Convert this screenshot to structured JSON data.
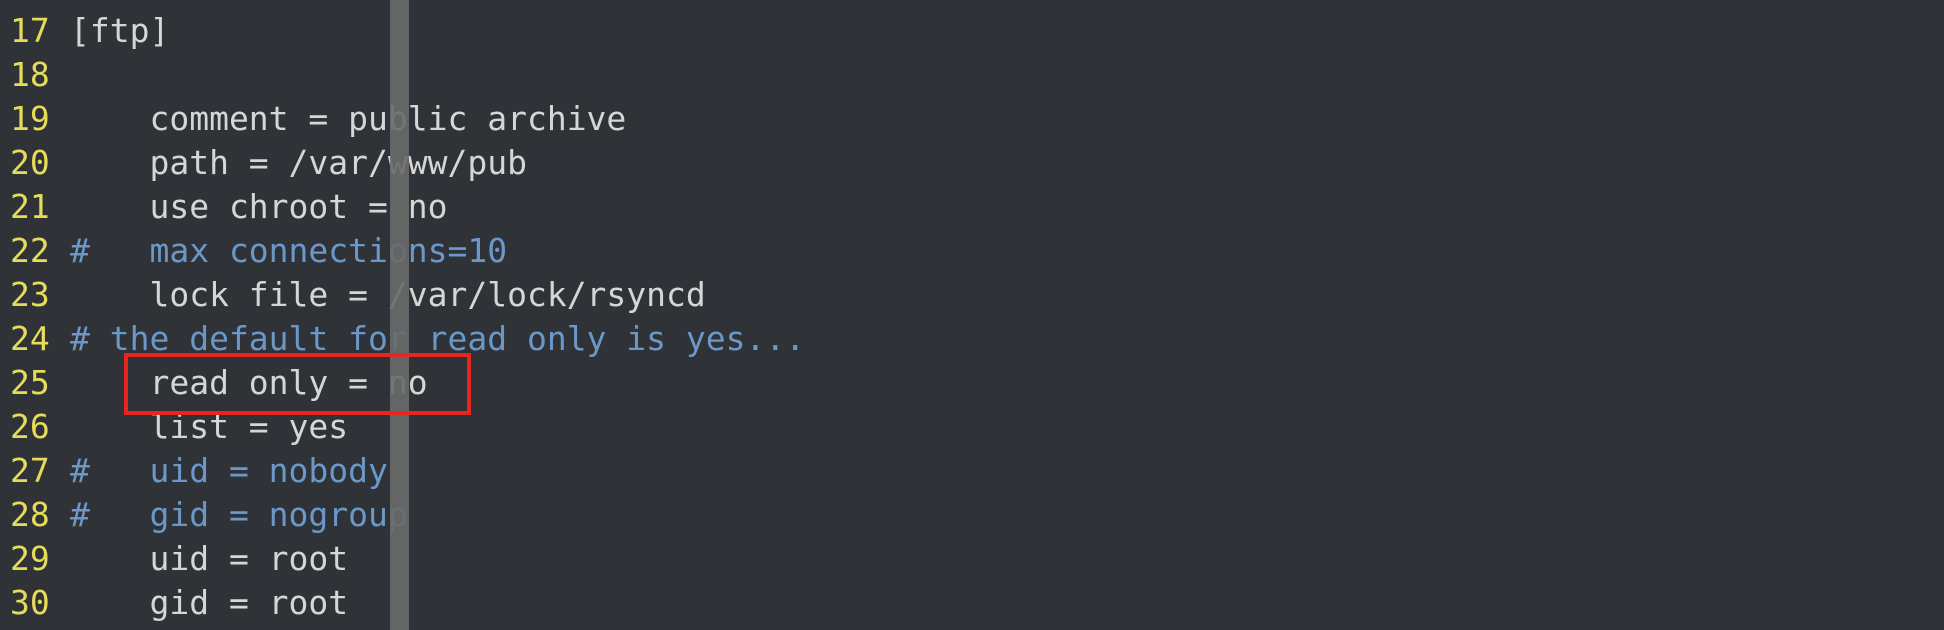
{
  "editor": {
    "lines": [
      {
        "number": "17",
        "text": "[ftp]",
        "comment": false
      },
      {
        "number": "18",
        "text": "",
        "comment": false
      },
      {
        "number": "19",
        "text": "    comment = public archive",
        "comment": false
      },
      {
        "number": "20",
        "text": "    path = /var/www/pub",
        "comment": false
      },
      {
        "number": "21",
        "text": "    use chroot = no",
        "comment": false
      },
      {
        "number": "22",
        "text": "#   max connections=10",
        "comment": true
      },
      {
        "number": "23",
        "text": "    lock file = /var/lock/rsyncd",
        "comment": false
      },
      {
        "number": "24",
        "text": "# the default for read only is yes...",
        "comment": true
      },
      {
        "number": "25",
        "text": "    read only = no",
        "comment": false
      },
      {
        "number": "26",
        "text": "    list = yes",
        "comment": false
      },
      {
        "number": "27",
        "text": "#   uid = nobody",
        "comment": true
      },
      {
        "number": "28",
        "text": "#   gid = nogroup",
        "comment": true
      },
      {
        "number": "29",
        "text": "    uid = root",
        "comment": false
      },
      {
        "number": "30",
        "text": "    gid = root",
        "comment": false
      }
    ],
    "highlighted_line": "25",
    "colors": {
      "background": "#2f3337",
      "line_number": "#e6dc5a",
      "text": "#d4d6d8",
      "comment": "#6b98c8",
      "highlight_box": "#e8251f"
    }
  }
}
